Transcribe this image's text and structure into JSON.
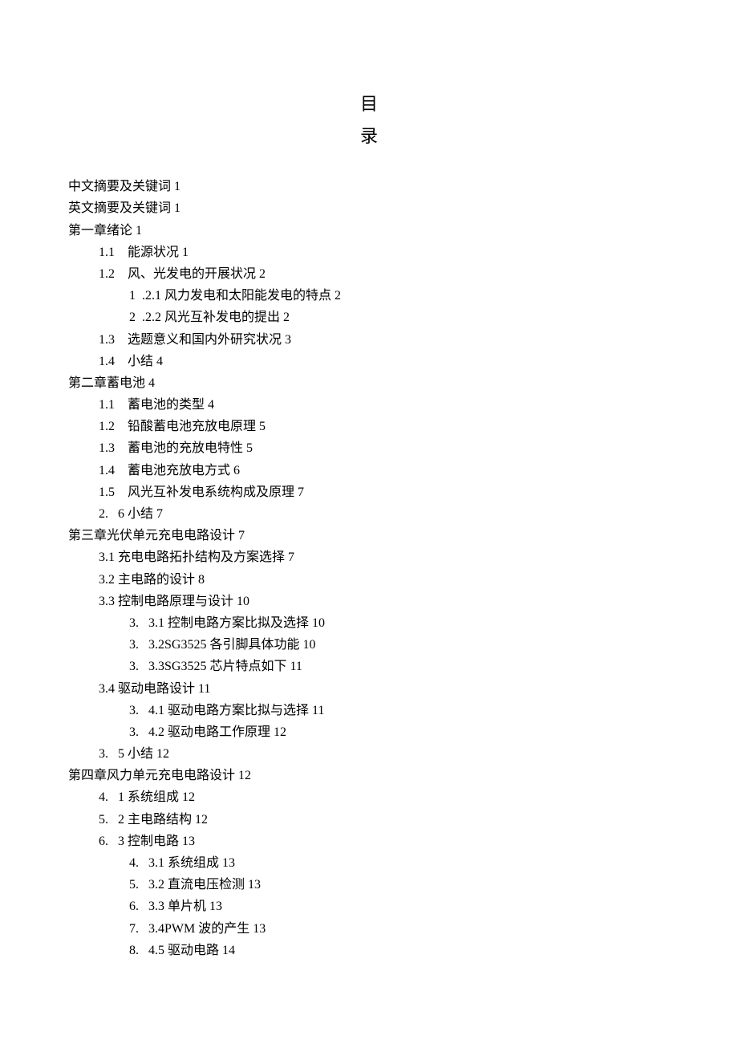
{
  "title": {
    "char1": "目",
    "char2": "录"
  },
  "toc": [
    {
      "level": 0,
      "text": "中文摘要及关键词 1"
    },
    {
      "level": 0,
      "text": "英文摘要及关键词 1"
    },
    {
      "level": 0,
      "text": "第一章绪论 1"
    },
    {
      "level": 1,
      "text": "1.1    能源状况 1"
    },
    {
      "level": 1,
      "text": "1.2    风、光发电的开展状况 2"
    },
    {
      "level": 2,
      "text": "1  .2.1 风力发电和太阳能发电的特点 2"
    },
    {
      "level": 2,
      "text": "2  .2.2 风光互补发电的提出 2"
    },
    {
      "level": 1,
      "text": "1.3    选题意义和国内外研究状况 3"
    },
    {
      "level": 1,
      "text": "1.4    小结 4"
    },
    {
      "level": 0,
      "text": "第二章蓄电池 4"
    },
    {
      "level": 1,
      "text": "1.1    蓄电池的类型 4"
    },
    {
      "level": 1,
      "text": "1.2    铅酸蓄电池充放电原理 5"
    },
    {
      "level": 1,
      "text": "1.3    蓄电池的充放电特性 5"
    },
    {
      "level": 1,
      "text": "1.4    蓄电池充放电方式 6"
    },
    {
      "level": 1,
      "text": "1.5    风光互补发电系统构成及原理 7"
    },
    {
      "level": 1,
      "text": "2.   6 小结 7"
    },
    {
      "level": 0,
      "text": "第三章光伏单元充电电路设计 7"
    },
    {
      "level": 1,
      "text": "3.1 充电电路拓扑结构及方案选择 7"
    },
    {
      "level": 1,
      "text": "3.2 主电路的设计 8"
    },
    {
      "level": 1,
      "text": "3.3 控制电路原理与设计 10"
    },
    {
      "level": 2,
      "text": "3.   3.1 控制电路方案比拟及选择 10"
    },
    {
      "level": 2,
      "text": "3.   3.2SG3525 各引脚具体功能 10"
    },
    {
      "level": 2,
      "text": "3.   3.3SG3525 芯片特点如下 11"
    },
    {
      "level": 1,
      "text": "3.4 驱动电路设计 11"
    },
    {
      "level": 2,
      "text": "3.   4.1 驱动电路方案比拟与选择 11"
    },
    {
      "level": 2,
      "text": "3.   4.2 驱动电路工作原理 12"
    },
    {
      "level": 1,
      "text": "3.   5 小结 12"
    },
    {
      "level": 0,
      "text": "第四章风力单元充电电路设计 12"
    },
    {
      "level": 1,
      "text": "4.   1 系统组成 12"
    },
    {
      "level": 1,
      "text": "5.   2 主电路结构 12"
    },
    {
      "level": 1,
      "text": "6.   3 控制电路 13"
    },
    {
      "level": 2,
      "text": "4.   3.1 系统组成 13"
    },
    {
      "level": 2,
      "text": "5.   3.2 直流电压检测 13"
    },
    {
      "level": 2,
      "text": "6.   3.3 单片机 13"
    },
    {
      "level": 2,
      "text": "7.   3.4PWM 波的产生 13"
    },
    {
      "level": 2,
      "text": "8.   4.5 驱动电路 14"
    }
  ]
}
